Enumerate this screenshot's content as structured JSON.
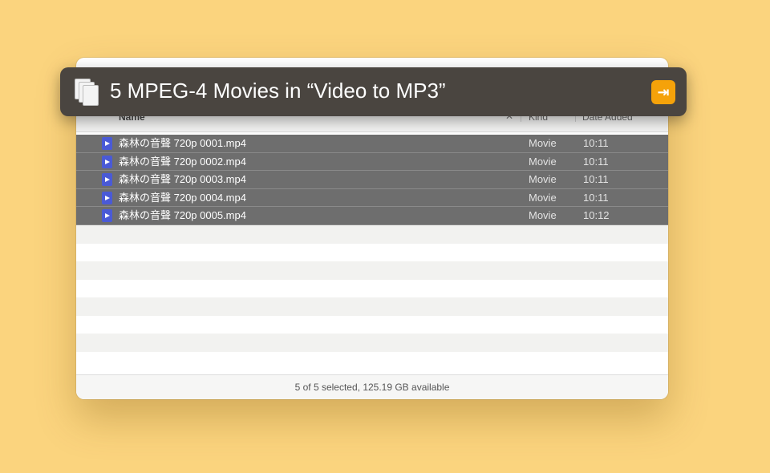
{
  "window": {
    "columns": {
      "name": "Name",
      "kind": "Kind",
      "date": "Date Added",
      "close_glyph": "✕"
    },
    "files": [
      {
        "name": "森林の音聲 720p 0001.mp4",
        "kind": "Movie",
        "date": "10:11"
      },
      {
        "name": "森林の音聲 720p 0002.mp4",
        "kind": "Movie",
        "date": "10:11"
      },
      {
        "name": "森林の音聲 720p 0003.mp4",
        "kind": "Movie",
        "date": "10:11"
      },
      {
        "name": "森林の音聲 720p 0004.mp4",
        "kind": "Movie",
        "date": "10:11"
      },
      {
        "name": "森林の音聲 720p 0005.mp4",
        "kind": "Movie",
        "date": "10:12"
      }
    ],
    "status": "5 of 5 selected, 125.19 GB available"
  },
  "share_bar": {
    "title": "5 MPEG-4 Movies in “Video to MP3”",
    "go_glyph": "⇥",
    "accent": "#f5a20a"
  },
  "colors": {
    "background": "#fbd47e",
    "selection": "#6e6e6e",
    "file_icon": "#4a5ad6"
  }
}
